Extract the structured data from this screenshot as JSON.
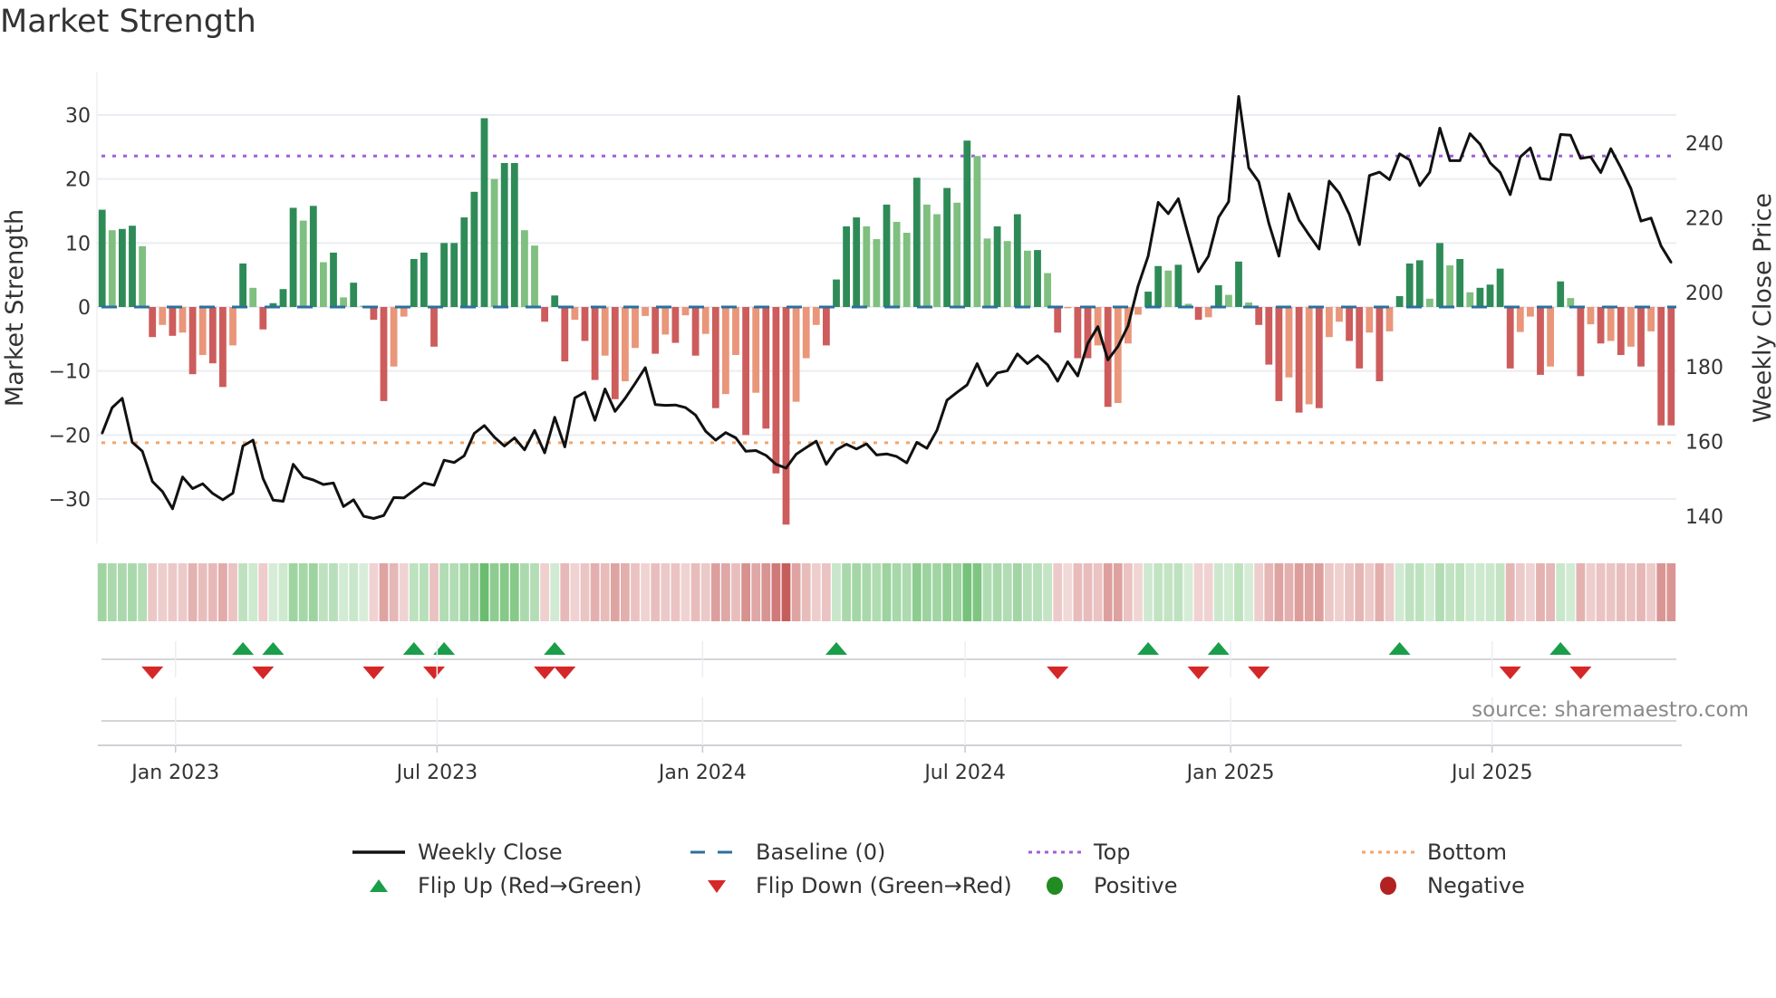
{
  "chart_data": {
    "type": "bar",
    "title": "Market Strength",
    "ylabel": "Market Strength",
    "y2label": "Weekly Close Price",
    "ylim": [
      -37,
      37
    ],
    "y2lim": [
      131,
      253
    ],
    "yticks": [
      30,
      20,
      10,
      0,
      -10,
      -20,
      -30
    ],
    "ytick_labels": [
      "30",
      "20",
      "10",
      "0",
      "−10",
      "−20",
      "−30"
    ],
    "y2ticks": [
      240,
      220,
      200,
      180,
      160,
      140
    ],
    "y2tick_labels": [
      "240",
      "220",
      "200",
      "180",
      "160",
      "140"
    ],
    "xticks": [
      {
        "week": 7.3,
        "label": "Jan 2023"
      },
      {
        "week": 33.3,
        "label": "Jul 2023"
      },
      {
        "week": 59.7,
        "label": "Jan 2024"
      },
      {
        "week": 85.8,
        "label": "Jul 2024"
      },
      {
        "week": 112.2,
        "label": "Jan 2025"
      },
      {
        "week": 138.2,
        "label": "Jul 2025"
      }
    ],
    "top_level": 23.6,
    "bottom_level": -21.2,
    "baseline": 0,
    "grid": true,
    "legend_placement": "bottom",
    "series": [
      {
        "name": "Market Strength",
        "type": "bar",
        "values": [
          15.2,
          12,
          12.2,
          12.7,
          9.5,
          -4.7,
          -2.8,
          -4.5,
          -4,
          -10.5,
          -7.5,
          -8.8,
          -12.5,
          -6,
          6.8,
          3,
          -3.5,
          0.6,
          2.8,
          15.5,
          13.5,
          15.8,
          7,
          8.5,
          1.5,
          3.8,
          0.2,
          -2,
          -14.7,
          -9.3,
          -1.5,
          7.5,
          8.5,
          -6.2,
          10,
          10,
          14,
          18,
          29.5,
          20,
          22.5,
          22.5,
          12,
          9.6,
          -2.3,
          1.8,
          -8.5,
          -2,
          -5.3,
          -11.4,
          -7.6,
          -14.4,
          -11.6,
          -6.4,
          -1.4,
          -7.3,
          -4.3,
          -5.6,
          -1.3,
          -7.6,
          -4.2,
          -15.8,
          -13.6,
          -7.5,
          -20,
          -13.4,
          -19,
          -26,
          -34,
          -14.8,
          -8,
          -2.8,
          -6,
          4.3,
          12.6,
          14,
          12.6,
          10.6,
          16,
          13.3,
          11.6,
          20.2,
          16,
          14.5,
          18.6,
          16.3,
          26,
          23.6,
          10.7,
          12.6,
          10.3,
          14.5,
          8.8,
          8.9,
          5.3,
          -4,
          -0.2,
          -8,
          -8,
          -6,
          -15.6,
          -15,
          -5.7,
          -1.2,
          2.4,
          6.4,
          5.7,
          6.6,
          0.5,
          -2,
          -1.6,
          3.4,
          1.9,
          7.1,
          0.7,
          -2.8,
          -9,
          -14.7,
          -11,
          -16.5,
          -15.2,
          -15.8,
          -4.7,
          -2.3,
          -5.3,
          -9.6,
          -4,
          -11.6,
          -3.8,
          1.7,
          6.8,
          7.3,
          1.3,
          10,
          6.5,
          7.5,
          2.3,
          3,
          3.5,
          6,
          -9.6,
          -3.9,
          -1.5,
          -10.6,
          -9.3,
          4,
          1.4,
          -10.8,
          -2.7,
          -5.7,
          -5.3,
          -7.5,
          -6.2,
          -9.3,
          -3.8,
          -18.5,
          -18.5
        ]
      },
      {
        "name": "Weekly Close",
        "type": "line",
        "values": [
          162.2,
          169.1,
          171.6,
          159.8,
          157.4,
          149.3,
          146.6,
          142,
          150.5,
          147.4,
          148.7,
          146.1,
          144.4,
          146.2,
          158.8,
          160.4,
          150.1,
          144.3,
          144,
          153.9,
          150.5,
          149.7,
          148.5,
          148.9,
          142.6,
          144.4,
          140,
          139.4,
          140.2,
          145,
          144.9,
          146.9,
          148.9,
          148.3,
          155,
          154.4,
          156.2,
          162.2,
          164.3,
          161.2,
          158.8,
          161,
          157.8,
          163,
          157,
          166.5,
          158.6,
          171.7,
          173.2,
          165.7,
          174.1,
          168.1,
          171.6,
          175.6,
          179.8,
          169.9,
          169.7,
          169.8,
          169.1,
          167.1,
          162.8,
          160.4,
          162.4,
          161,
          157.4,
          157.6,
          156.3,
          153.9,
          152.9,
          156.6,
          158.4,
          160.1,
          153.9,
          157.8,
          159.3,
          158,
          159.4,
          156.4,
          156.7,
          156,
          154.3,
          159.8,
          158.2,
          163,
          171.1,
          173.2,
          175.2,
          180.9,
          175,
          178.4,
          179,
          183.5,
          180.9,
          183,
          180.6,
          176.2,
          181.4,
          177.6,
          186.3,
          190.8,
          181.9,
          185.5,
          191,
          201.7,
          209.7,
          224.1,
          221.1,
          225.1,
          215.2,
          205.5,
          209.7,
          220.1,
          224.3,
          252.5,
          233.4,
          229.6,
          218.5,
          209.7,
          226.4,
          219.4,
          215.4,
          211.6,
          229.8,
          226.6,
          220.9,
          212.8,
          231.3,
          232.2,
          230.2,
          237.1,
          235.5,
          228.6,
          232.2,
          244,
          235.3,
          235.3,
          242.5,
          239.7,
          234.7,
          232.1,
          226.2,
          236.3,
          238.7,
          230.5,
          230.2,
          242.3,
          242.1,
          235.9,
          236.3,
          232.1,
          238.5,
          233.4,
          227.8,
          219.1,
          219.9,
          212.4,
          208
        ]
      }
    ],
    "flip_up_weeks": [
      14,
      17,
      31,
      34,
      45,
      73,
      104,
      111,
      129,
      145
    ],
    "flip_down_weeks": [
      5,
      16,
      27,
      33,
      44,
      46,
      95,
      109,
      115,
      140,
      147
    ],
    "annotation": "source: sharemaestro.com",
    "legend": [
      {
        "label": "Weekly Close",
        "marker": "solid-line",
        "color": "#111111"
      },
      {
        "label": "Baseline (0)",
        "marker": "dashed-line",
        "color": "#2b6f9e"
      },
      {
        "label": "Top",
        "marker": "dotted-line",
        "color": "#a15fdc"
      },
      {
        "label": "Bottom",
        "marker": "dotted-line",
        "color": "#f2a56b"
      },
      {
        "label": "Flip Up (Red→Green)",
        "marker": "triangle-up",
        "color": "#1a9e4a"
      },
      {
        "label": "Flip Down (Green→Red)",
        "marker": "triangle-down",
        "color": "#d62728"
      },
      {
        "label": "Positive",
        "marker": "circle",
        "color": "#228b22"
      },
      {
        "label": "Negative",
        "marker": "circle",
        "color": "#b22222"
      }
    ]
  },
  "colors": {
    "pos_rising": "#2e8b57",
    "pos_falling": "#7fbf7f",
    "neg_falling": "#cd5c5c",
    "neg_rising": "#e9967a",
    "heat_pos": "76,175,80",
    "heat_neg": "192,80,77",
    "grid": "#ebedf2"
  }
}
